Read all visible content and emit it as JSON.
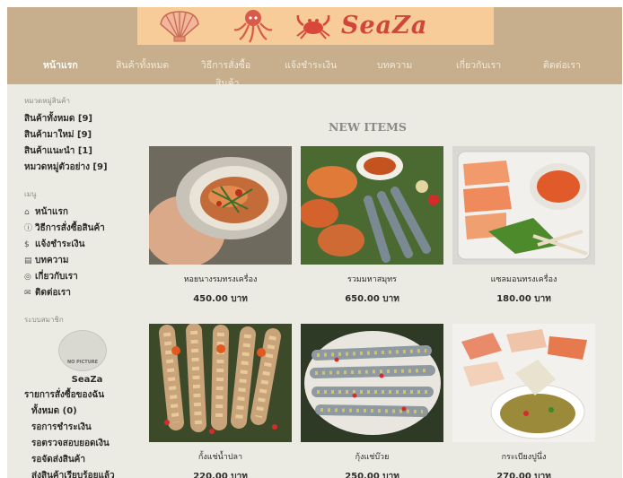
{
  "brand": {
    "name": "SeaZa"
  },
  "nav": {
    "items": [
      "หน้าแรก",
      "สินค้าทั้งหมด",
      "วิธีการสั่งซื้อ",
      "แจ้งชำระเงิน",
      "บทความ",
      "เกี่ยวกับเรา",
      "ติดต่อเรา"
    ],
    "wrap_tail": "สินค้า"
  },
  "sidebar": {
    "categories_heading": "หมวดหมู่สินค้า",
    "categories": [
      "สินค้าทั้งหมด [9]",
      "สินค้ามาใหม่ [9]",
      "สินค้าแนะนำ [1]",
      "หมวดหมู่ตัวอย่าง [9]"
    ],
    "menu_heading": "เมนู",
    "menu": [
      {
        "icon": "⌂",
        "label": "หน้าแรก"
      },
      {
        "icon": "ⓘ",
        "label": "วิธีการสั่งซื้อสินค้า"
      },
      {
        "icon": "$",
        "label": "แจ้งชำระเงิน"
      },
      {
        "icon": "▤",
        "label": "บทความ"
      },
      {
        "icon": "◎",
        "label": "เกี่ยวกับเรา"
      },
      {
        "icon": "✉",
        "label": "ติดต่อเรา"
      }
    ],
    "member_heading": "ระบบสมาชิก",
    "avatar_text": "NO PICTURE",
    "user_name": "SeaZa",
    "orders_heading": "รายการสั่งซื้อของฉัน",
    "orders": [
      "ทั้งหมด (0)",
      "รอการชำระเงิน",
      "รอตรวจสอบยอดเงิน",
      "รอจัดส่งสินค้า",
      "ส่งสินค้าเรียบร้อยแล้ว"
    ]
  },
  "main": {
    "title": "NEW ITEMS",
    "products": [
      {
        "name": "หอยนางรมทรงเครื่อง",
        "price": "450.00 บาท"
      },
      {
        "name": "รวมมหาสมุทร",
        "price": "650.00 บาท"
      },
      {
        "name": "แซลมอนทรงเครื่อง",
        "price": "180.00 บาท"
      },
      {
        "name": "กั้งแช่น้ำปลา",
        "price": "220.00 บาท"
      },
      {
        "name": "กุ้งแช่บ๊วย",
        "price": "250.00 บาท"
      },
      {
        "name": "กระเบียงปูนึ่ง",
        "price": "270.00 บาท"
      }
    ]
  }
}
